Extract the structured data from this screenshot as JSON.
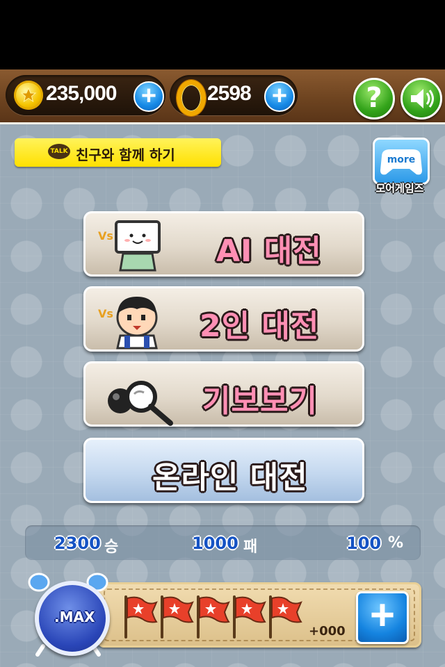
{
  "header": {
    "coins": "235,000",
    "rings": "2598",
    "help_icon": "question-mark-icon",
    "sound_icon": "speaker-icon"
  },
  "social": {
    "talk_badge": "TALK",
    "label": "친구와 함께 하기"
  },
  "more_games": {
    "icon_text": "more",
    "label": "모어게임즈"
  },
  "menu": [
    {
      "label": "AI 대전",
      "vs": "Vs"
    },
    {
      "label": "2인 대전",
      "vs": "Vs"
    },
    {
      "label": "기보보기"
    },
    {
      "label": "온라인 대전"
    }
  ],
  "stats": {
    "wins": "2300",
    "wins_unit": "승",
    "losses": "1000",
    "losses_unit": "패",
    "rate": "100",
    "rate_unit": "%"
  },
  "energy": {
    "max_label": ".MAX",
    "flags": 5,
    "bonus": "+000",
    "plus_label": "+"
  },
  "colors": {
    "menu_text": "#ff8fb4",
    "stat_value": "#1553c4",
    "accent_blue": "#1689e6",
    "accent_green": "#33a31a"
  }
}
